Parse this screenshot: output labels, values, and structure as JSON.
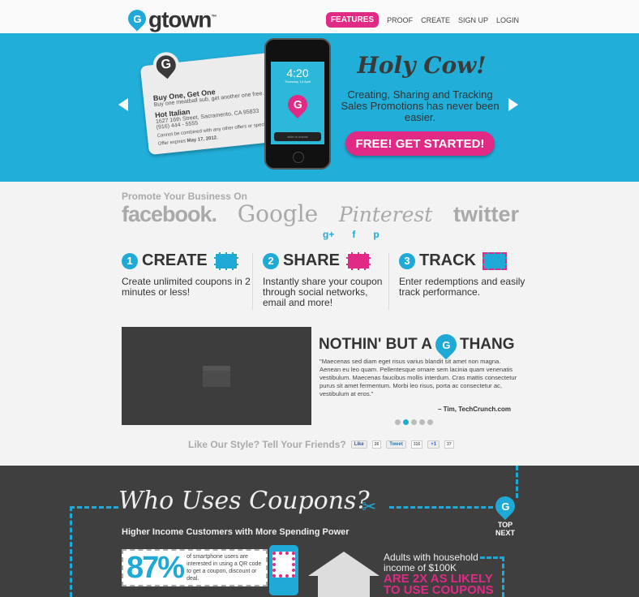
{
  "header": {
    "logo": "gtown",
    "logo_tm": "™",
    "logo_pin": "G",
    "nav": [
      "FEATURES",
      "PROOF",
      "CREATE",
      "SIGN UP",
      "LOGIN"
    ]
  },
  "hero": {
    "coupon": {
      "title": "Buy One, Get One",
      "desc": "Buy one meatball sub, get another one free.",
      "business": "Hot Italian",
      "address": "1627 16th Street, Sacramento, CA 95833",
      "phone": "(916) 444 - 5555",
      "fine": "Cannot be combined with any other offers or specials.",
      "expires_label": "Offer expires",
      "expires": "May 17, 2012."
    },
    "phone": {
      "time": "4:20",
      "date": "Thursday, 14 April",
      "unlock": "slide to unlock"
    },
    "title": "Holy Cow!",
    "subtitle": "Creating, Sharing and Tracking Sales Promotions has never been easier.",
    "cta": "FREE! GET STARTED!"
  },
  "promote": {
    "label": "Promote Your Business On",
    "networks": [
      "facebook.",
      "Google",
      "Pinterest",
      "twitter"
    ]
  },
  "steps": [
    {
      "num": "1",
      "title": "CREATE",
      "desc": "Create unlimited coupons in 2 minutes or less!"
    },
    {
      "num": "2",
      "title": "SHARE",
      "desc": "Instantly share your coupon through social networks, email and more!"
    },
    {
      "num": "3",
      "title": "TRACK",
      "desc": "Enter redemptions and easily track performance."
    }
  ],
  "share_icons": [
    "g+",
    "f",
    "p"
  ],
  "testimonial": {
    "title_a": "NOTHIN' BUT A",
    "title_pin": "G",
    "title_b": "THANG",
    "quote": "\"Maecenas sed diam eget risus varius blandit sit amet non magna. Aenean eu leo quam. Pellentesque ornare sem lacinia quam venenatis vestibulum. Maecenas faucibus mollis interdum. Cras mattis consectetur purus sit amet fermentum. Morbi leo risus, porta ac consectetur ac, vestibulum at eros.\"",
    "author": "– Tim, TechCrunch.com",
    "active_dot": 1
  },
  "friends": {
    "label": "Like Our Style? Tell Your Friends?",
    "like": "Like",
    "like_count": "26",
    "tweet": "Tweet",
    "tweet_count": "316",
    "plus": "+1",
    "plus_count": "37"
  },
  "infographic": {
    "title": "Who Uses Coupons?",
    "subtitle": "Higher Income Customers with More Spending Power",
    "top": "TOP",
    "next": "NEXT",
    "stat_pct": "87%",
    "stat_text": "of smartphone users are interested in using a QR code to get a coupon, discount or deal.",
    "adults": "Adults with household income of $100K",
    "likely": "ARE 2X AS LIKELY TO USE COUPONS"
  }
}
